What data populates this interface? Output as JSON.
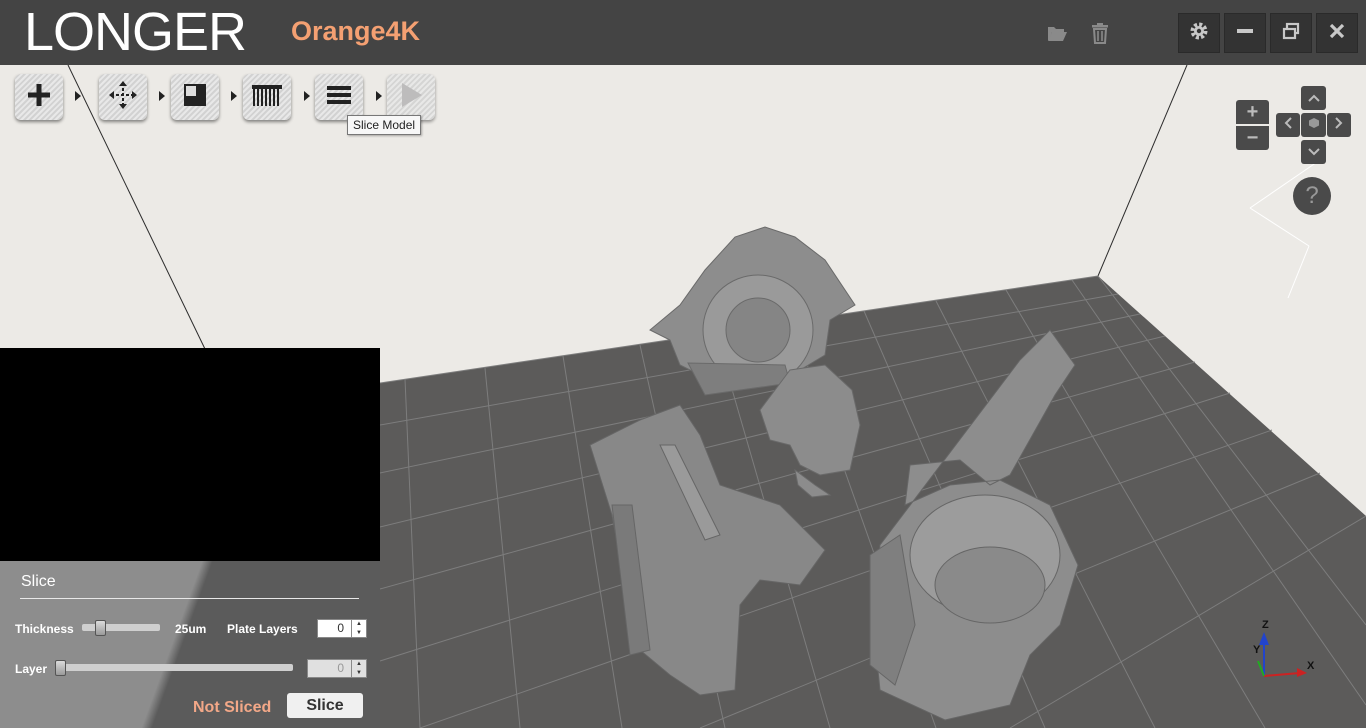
{
  "app": {
    "logo": "LONGER",
    "model": "Orange4K"
  },
  "titlebar": {
    "icons": [
      "folder-open-icon",
      "trash-icon"
    ],
    "window_buttons": [
      "gear-icon",
      "minimize-icon",
      "restore-icon",
      "close-icon"
    ]
  },
  "toolbar": {
    "steps": [
      "add-icon",
      "move-icon",
      "support-icon",
      "layers-icon",
      "menu-icon",
      "play-icon"
    ],
    "tooltip": "Slice Model"
  },
  "nav": {
    "zoom_in": "+",
    "zoom_out": "−",
    "help": "?"
  },
  "axes": {
    "z": "Z",
    "y": "Y",
    "x": "X"
  },
  "slice": {
    "title": "Slice",
    "thickness_label": "Thickness",
    "thickness_value": "25um",
    "thickness_level": 0.2,
    "plate_layers_label": "Plate Layers",
    "plate_layers_value": "0",
    "layer_label": "Layer",
    "layer_value": "0",
    "layer_level": 0,
    "status": "Not Sliced",
    "slice_button": "Slice"
  },
  "colors": {
    "titlebar": "#444444",
    "model_name": "#f4a072",
    "plate": "#5c5b5a",
    "mesh": "#7d7d7d",
    "status": "#f3a888"
  }
}
